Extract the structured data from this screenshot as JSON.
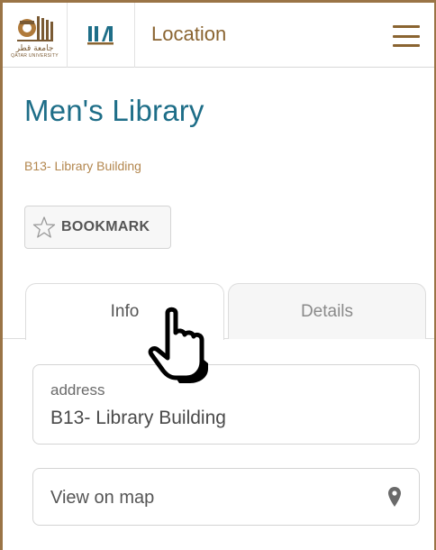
{
  "header": {
    "logo": {
      "arabic_text": "جامعة قطر",
      "latin_text": "QATAR UNIVERSITY",
      "icon": "qatar-university-logo"
    },
    "books_icon": "books-icon",
    "title": "Location",
    "menu_icon": "hamburger-menu-icon"
  },
  "main": {
    "title": "Men's Library",
    "subtitle": "B13- Library Building",
    "bookmark": {
      "label": "BOOKMARK",
      "icon": "star-outline-icon"
    },
    "tabs": [
      {
        "label": "Info",
        "active": true
      },
      {
        "label": "Details",
        "active": false
      }
    ],
    "address": {
      "key": "address",
      "value": "B13- Library Building"
    },
    "map_link": {
      "label": "View on map",
      "icon": "map-pin-icon"
    }
  },
  "cursor": {
    "icon": "pointing-hand-cursor-icon"
  },
  "colors": {
    "brand_gold": "#8a6431",
    "title_teal": "#1e6e88",
    "subtitle_tan": "#b3874f",
    "frame_border": "#9a7446"
  }
}
